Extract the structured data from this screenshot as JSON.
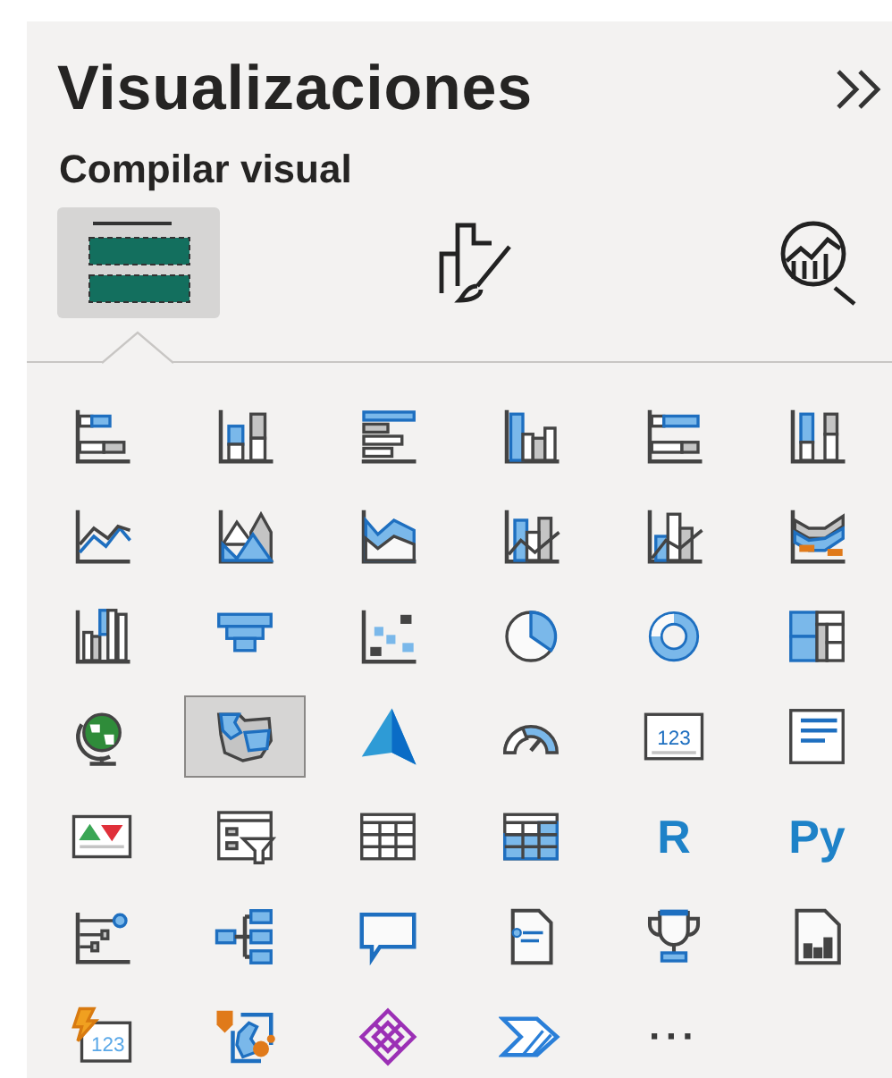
{
  "pane": {
    "title": "Visualizaciones",
    "subtitle": "Compilar visual"
  },
  "tabs": [
    {
      "kind": "build",
      "selected": true
    },
    {
      "kind": "format",
      "selected": false
    },
    {
      "kind": "analytics",
      "selected": false
    }
  ],
  "visuals": [
    {
      "kind": "stacked-bar",
      "selected": false
    },
    {
      "kind": "stacked-column",
      "selected": false
    },
    {
      "kind": "clustered-bar",
      "selected": false
    },
    {
      "kind": "clustered-column",
      "selected": false
    },
    {
      "kind": "bar-100",
      "selected": false
    },
    {
      "kind": "column-100",
      "selected": false
    },
    {
      "kind": "line",
      "selected": false
    },
    {
      "kind": "area",
      "selected": false
    },
    {
      "kind": "stacked-area",
      "selected": false
    },
    {
      "kind": "line-column",
      "selected": false
    },
    {
      "kind": "line-clustered",
      "selected": false
    },
    {
      "kind": "ribbon",
      "selected": false
    },
    {
      "kind": "waterfall",
      "selected": false
    },
    {
      "kind": "funnel",
      "selected": false
    },
    {
      "kind": "scatter",
      "selected": false
    },
    {
      "kind": "pie",
      "selected": false
    },
    {
      "kind": "donut",
      "selected": false
    },
    {
      "kind": "treemap",
      "selected": false
    },
    {
      "kind": "globe",
      "selected": false
    },
    {
      "kind": "filled-map",
      "selected": true
    },
    {
      "kind": "arrow",
      "selected": false
    },
    {
      "kind": "gauge",
      "selected": false
    },
    {
      "kind": "card",
      "selected": false,
      "text": "123"
    },
    {
      "kind": "multirow-card",
      "selected": false
    },
    {
      "kind": "kpi",
      "selected": false
    },
    {
      "kind": "slicer",
      "selected": false
    },
    {
      "kind": "table",
      "selected": false
    },
    {
      "kind": "matrix",
      "selected": false
    },
    {
      "kind": "letters",
      "selected": false,
      "text": "R"
    },
    {
      "kind": "letters",
      "selected": false,
      "text": "Py"
    },
    {
      "kind": "key-influencers",
      "selected": false
    },
    {
      "kind": "decomposition",
      "selected": false
    },
    {
      "kind": "speech",
      "selected": false
    },
    {
      "kind": "document",
      "selected": false
    },
    {
      "kind": "trophy",
      "selected": false
    },
    {
      "kind": "report",
      "selected": false
    },
    {
      "kind": "metric",
      "selected": false,
      "text": "123"
    },
    {
      "kind": "pin-map",
      "selected": false
    },
    {
      "kind": "diamond",
      "selected": false
    },
    {
      "kind": "chevron",
      "selected": false
    },
    {
      "kind": "dots",
      "selected": false,
      "text": "···"
    }
  ]
}
